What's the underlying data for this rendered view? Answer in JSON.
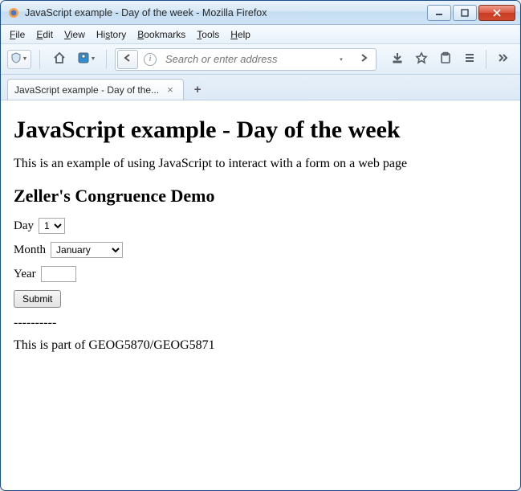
{
  "window": {
    "title": "JavaScript example - Day of the week - Mozilla Firefox"
  },
  "menubar": {
    "items": [
      "File",
      "Edit",
      "View",
      "History",
      "Bookmarks",
      "Tools",
      "Help"
    ]
  },
  "toolbar": {
    "address_placeholder": "Search or enter address"
  },
  "tab": {
    "label": "JavaScript example - Day of the..."
  },
  "page": {
    "h1": "JavaScript example - Day of the week",
    "intro": "This is an example of using JavaScript to interact with a form on a web page",
    "h2": "Zeller's Congruence Demo",
    "labels": {
      "day": "Day",
      "month": "Month",
      "year": "Year",
      "submit": "Submit"
    },
    "day_value": "1",
    "month_value": "January",
    "year_value": "",
    "divider": "----------",
    "footer": "This is part of GEOG5870/GEOG5871"
  }
}
